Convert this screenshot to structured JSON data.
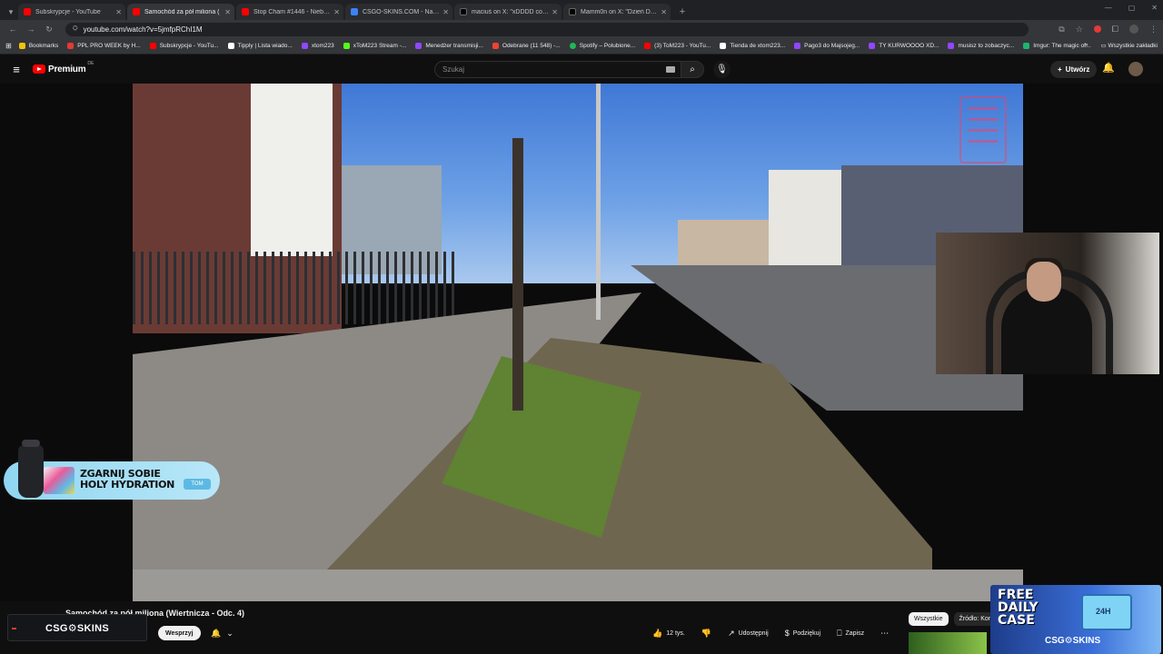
{
  "browser": {
    "tabs": [
      {
        "title": "Subskrypcje - YouTube",
        "color": "#ff0000",
        "active": false
      },
      {
        "title": "Samochód za pół miliona (",
        "color": "#ff0000",
        "active": true
      },
      {
        "title": "Stop Cham #1446 - Niebezpie",
        "color": "#ff0000",
        "active": false
      },
      {
        "title": "CSGO-SKINS.COM - Najlepsze",
        "color": "#3b82f6",
        "active": false
      },
      {
        "title": "maciuś on X: \"xDDDD co jest k",
        "color": "#000000",
        "active": false
      },
      {
        "title": "Mamm0n on X: \"Dzień Dobry",
        "color": "#000000",
        "active": false
      }
    ],
    "url": "youtube.com/watch?v=5jmfpRChI1M",
    "bookmarks": [
      {
        "label": "Bookmarks",
        "color": "#f4c20d"
      },
      {
        "label": "PPL PRO WEEK by H...",
        "color": "#e53935"
      },
      {
        "label": "Subskrypcje - YouTu...",
        "color": "#ff0000"
      },
      {
        "label": "Tipply | Lista wiado...",
        "color": "#ffffff"
      },
      {
        "label": "xtom223",
        "color": "#9146ff"
      },
      {
        "label": "xToM223 Stream -...",
        "color": "#53fc18"
      },
      {
        "label": "Menedżer transmisji...",
        "color": "#9146ff"
      },
      {
        "label": "Odebrane (11 548) -...",
        "color": "#ea4335"
      },
      {
        "label": "Spotify – Polubione...",
        "color": "#1db954"
      },
      {
        "label": "(3) ToM223 - YouTu...",
        "color": "#ff0000"
      },
      {
        "label": "Tienda de xtom223...",
        "color": "#ffffff"
      },
      {
        "label": "Pago3 do Majsojeg...",
        "color": "#9146ff"
      },
      {
        "label": "TY KURWOOOO XD...",
        "color": "#9146ff"
      },
      {
        "label": "musisz to zobaczyc...",
        "color": "#9146ff"
      },
      {
        "label": "Imgur: The magic of...",
        "color": "#1bb76e"
      }
    ],
    "bookmarks_more": "»",
    "all_bookmarks": "Wszystkie zakładki"
  },
  "youtube": {
    "logo_text": "Premium",
    "region": "DE",
    "search_placeholder": "Szukaj",
    "create_label": "Utwórz",
    "video_title": "Samochód za pół miliona (Wiertnicza - Odc. 4)",
    "support_label": "Wesprzyj",
    "likes": "12 tys.",
    "share_label": "Udostępnij",
    "thanks_label": "Podziękuj",
    "save_label": "Zapisz",
    "chips": [
      "Wszystkie",
      "Źródło: Kom"
    ]
  },
  "overlay": {
    "promo_line1": "ZGARNIJ SOBIE",
    "promo_line2": "HOLY HYDRATION",
    "promo_code": "TOM",
    "channel_brand": "CSG⚙SKINS",
    "daily_case_line1": "FREE",
    "daily_case_line2": "DAILY",
    "daily_case_line3": "CASE",
    "daily_case_brand": "CSG⚙SKINS"
  }
}
